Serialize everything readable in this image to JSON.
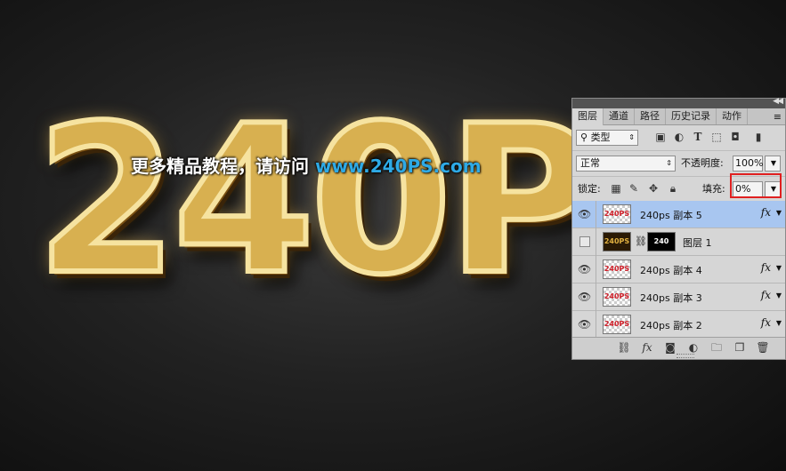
{
  "artwork": {
    "headline": "240P",
    "watermark_cn": "更多精品教程，请访问",
    "watermark_url": "www.240PS.com"
  },
  "panel": {
    "collapse_icon": "double-chevron-left-icon",
    "tabs": [
      "图层",
      "通道",
      "路径",
      "历史记录",
      "动作"
    ],
    "filter_label": "类型",
    "blend_mode": "正常",
    "opacity_label": "不透明度:",
    "opacity_value": "100%",
    "lock_label": "锁定:",
    "fill_label": "填充:",
    "fill_value": "0%",
    "layers": [
      {
        "name": "240ps 副本 5",
        "thumb": "240PS",
        "visible": true,
        "selected": true,
        "fx": "fx"
      },
      {
        "name": "图层 1",
        "thumb": "240PS",
        "visible": false,
        "selected": false,
        "mask": "240"
      },
      {
        "name": "240ps 副本 4",
        "thumb": "240PS",
        "visible": true,
        "selected": false,
        "fx": "fx"
      },
      {
        "name": "240ps 副本 3",
        "thumb": "240PS",
        "visible": true,
        "selected": false,
        "fx": "fx"
      },
      {
        "name": "240ps 副本 2",
        "thumb": "240PS",
        "visible": true,
        "selected": false,
        "fx": "fx"
      }
    ],
    "bottom_fx": "fx"
  },
  "colors": {
    "selection": "#a8c6f0",
    "highlight_box": "#e02020",
    "url_blue": "#2eaae6"
  }
}
